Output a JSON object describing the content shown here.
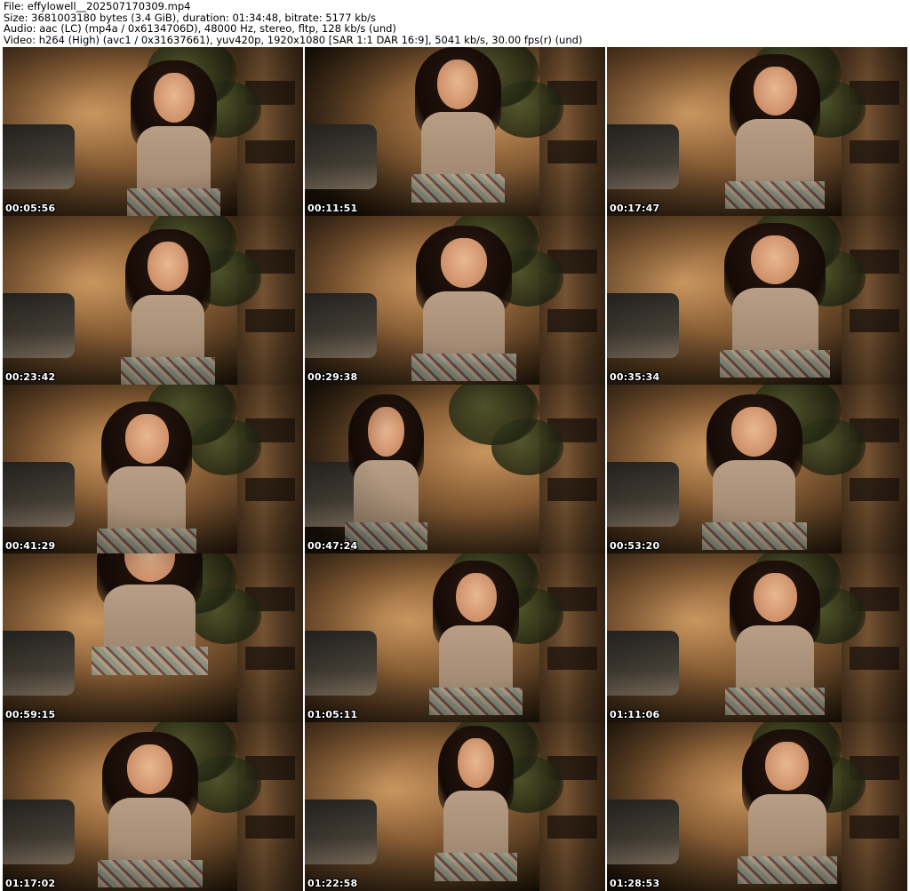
{
  "header": {
    "file": "File: effylowell__202507170309.mp4",
    "size": "Size: 3681003180 bytes (3.4 GiB), duration: 01:34:48, bitrate: 5177 kb/s",
    "audio": "Audio: aac (LC) (mp4a / 0x6134706D), 48000 Hz, stereo, fltp, 128 kb/s (und)",
    "video": "Video: h264 (High) (avc1 / 0x31637661), yuv420p, 1920x1080 [SAR 1:1 DAR 16:9], 5041 kb/s, 30.00 fps(r) (und)"
  },
  "thumbnails": [
    {
      "time": "00:05:56"
    },
    {
      "time": "00:11:51"
    },
    {
      "time": "00:17:47"
    },
    {
      "time": "00:23:42"
    },
    {
      "time": "00:29:38"
    },
    {
      "time": "00:35:34"
    },
    {
      "time": "00:41:29"
    },
    {
      "time": "00:47:24"
    },
    {
      "time": "00:53:20"
    },
    {
      "time": "00:59:15"
    },
    {
      "time": "01:05:11"
    },
    {
      "time": "01:11:06"
    },
    {
      "time": "01:17:02"
    },
    {
      "time": "01:22:58"
    },
    {
      "time": "01:28:53"
    }
  ],
  "colors": {
    "background": "#ffffff",
    "header_text": "#000000",
    "timestamp_text": "#ffffff",
    "scene_warm": "#c8955e",
    "scene_dark": "#1a1208"
  }
}
